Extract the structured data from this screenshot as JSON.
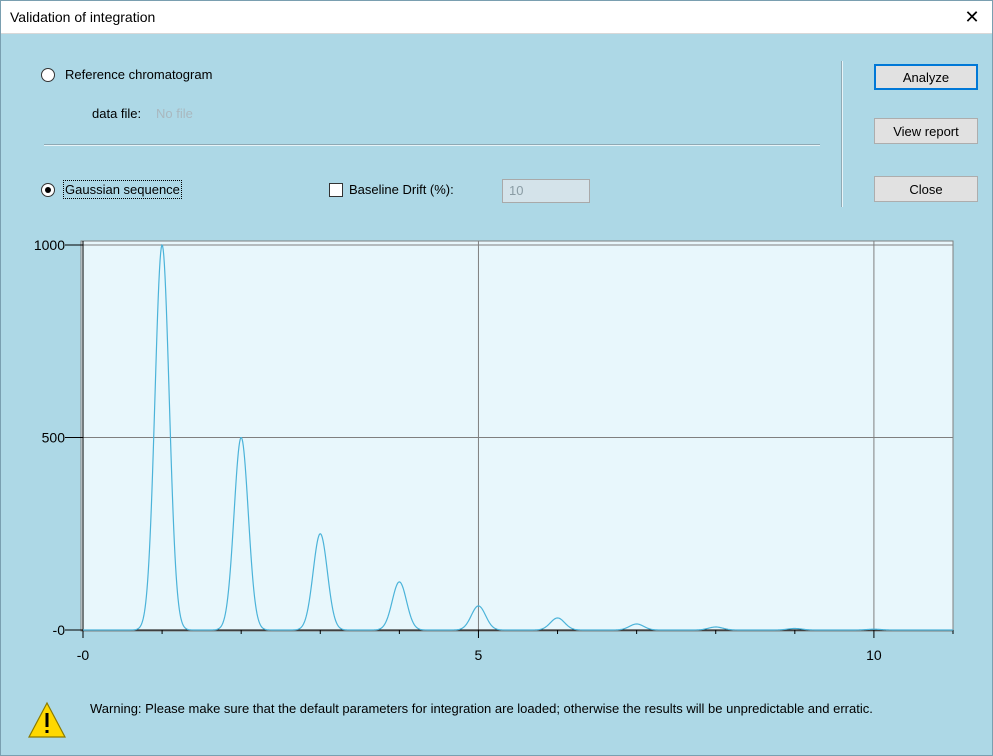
{
  "window": {
    "title": "Validation of integration"
  },
  "reference": {
    "label": "Reference chromatogram",
    "data_file_label": "data file:",
    "data_file_value": "No file"
  },
  "gaussian": {
    "label": "Gaussian sequence"
  },
  "baseline": {
    "label": "Baseline Drift (%):",
    "value": "10"
  },
  "buttons": {
    "analyze": "Analyze",
    "view_report": "View report",
    "close": "Close"
  },
  "warning": {
    "icon": "warning-icon",
    "text": "Warning: Please make sure that the default parameters for integration are loaded; otherwise the results will be unpredictable and erratic."
  },
  "chart_data": {
    "type": "line",
    "x_ticks": [
      "-0",
      "5",
      "10"
    ],
    "y_ticks": [
      "1000",
      "500",
      "-0"
    ],
    "xlim": [
      0,
      11
    ],
    "ylim": [
      0,
      1000
    ],
    "grid": true,
    "series": [
      {
        "line_color": "#4bb3d9",
        "peaks": [
          {
            "center": 1,
            "height": 1000
          },
          {
            "center": 2,
            "height": 500
          },
          {
            "center": 3,
            "height": 250
          },
          {
            "center": 4,
            "height": 125
          },
          {
            "center": 5,
            "height": 62.5
          },
          {
            "center": 6,
            "height": 31.25
          },
          {
            "center": 7,
            "height": 15.6
          },
          {
            "center": 8,
            "height": 7.8
          },
          {
            "center": 9,
            "height": 3.9
          },
          {
            "center": 10,
            "height": 2
          }
        ]
      }
    ]
  }
}
